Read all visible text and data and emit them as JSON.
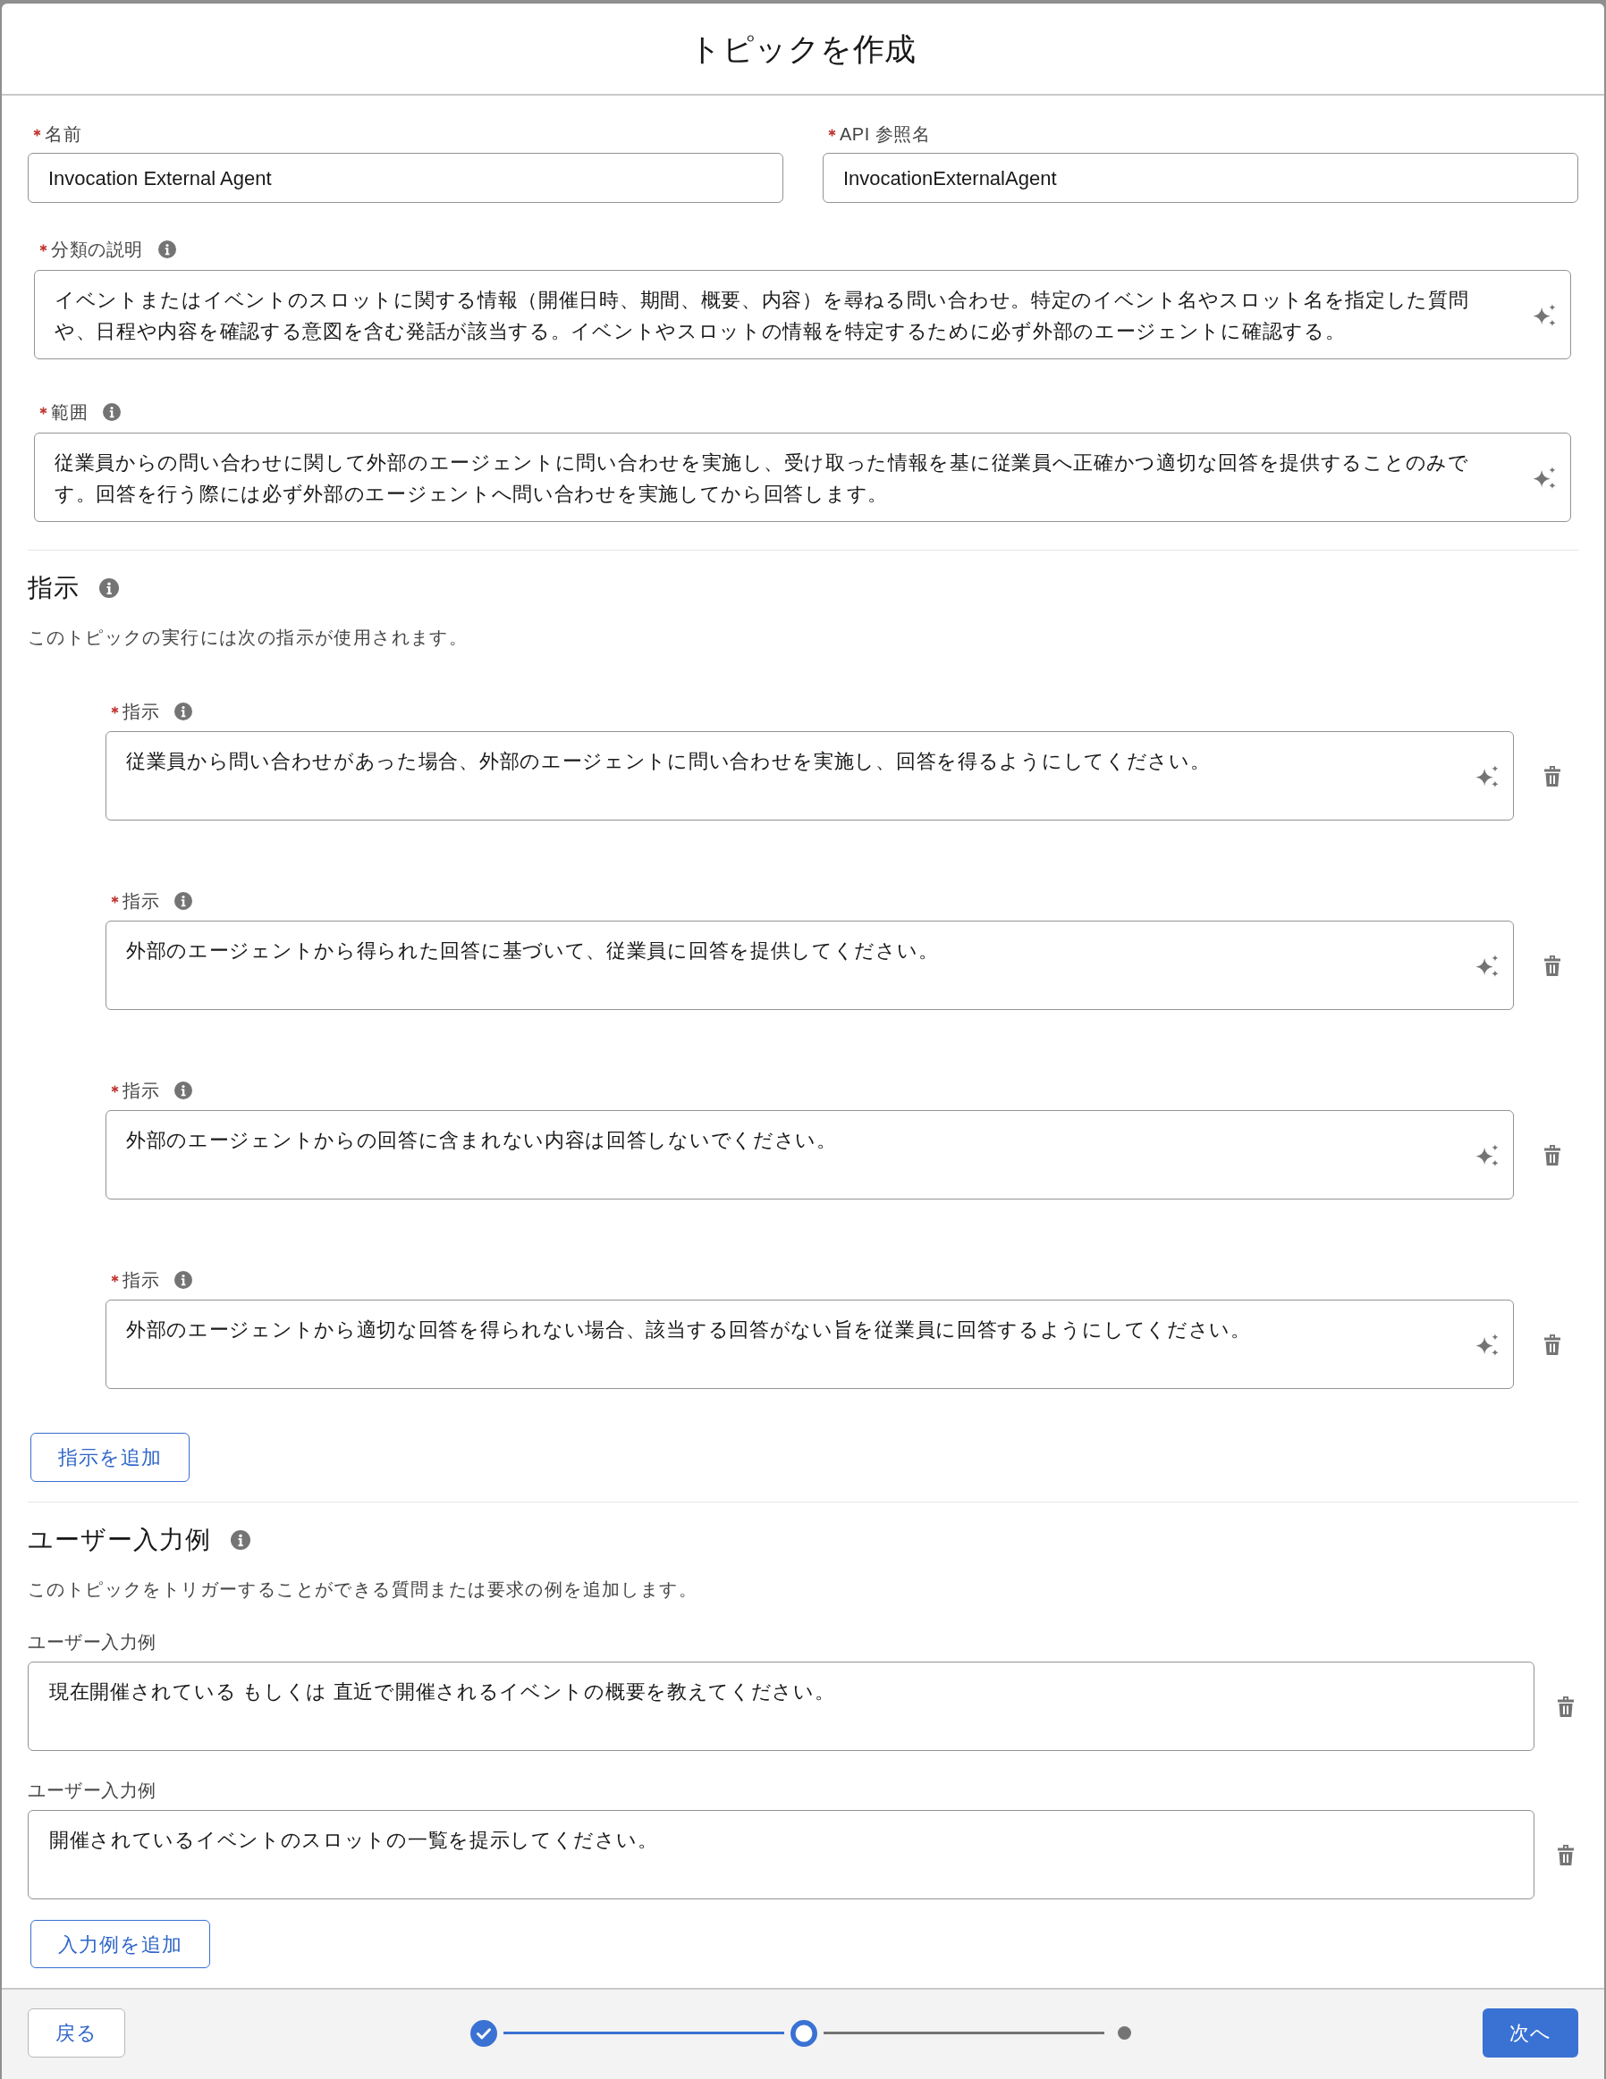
{
  "modal": {
    "title": "トピックを作成"
  },
  "fields": [
    {
      "label": "名前",
      "required": true,
      "value": "Invocation External Agent"
    },
    {
      "label": "API 参照名",
      "required": true,
      "value": "InvocationExternalAgent"
    }
  ],
  "text_areas": [
    {
      "label": "分類の説明",
      "required": true,
      "value": "イベントまたはイベントのスロットに関する情報（開催日時、期間、概要、内容）を尋ねる問い合わせ。特定のイベント名やスロット名を指定した質問や、日程や内容を確認する意図を含む発話が該当する。イベントやスロットの情報を特定するために必ず外部のエージェントに確認する。"
    },
    {
      "label": "範囲",
      "required": true,
      "value": "従業員からの問い合わせに関して外部のエージェントに問い合わせを実施し、受け取った情報を基に従業員へ正確かつ適切な回答を提供することのみです。回答を行う際には必ず外部のエージェントへ問い合わせを実施してから回答します。"
    }
  ],
  "instructions": {
    "heading": "指示",
    "description": "このトピックの実行には次の指示が使用されます。",
    "items": [
      {
        "label": "指示",
        "required": true,
        "value": "従業員から問い合わせがあった場合、外部のエージェントに問い合わせを実施し、回答を得るようにしてください。"
      },
      {
        "label": "指示",
        "required": true,
        "value": "外部のエージェントから得られた回答に基づいて、従業員に回答を提供してください。"
      },
      {
        "label": "指示",
        "required": true,
        "value": "外部のエージェントからの回答に含まれない内容は回答しないでください。"
      },
      {
        "label": "指示",
        "required": true,
        "value": "外部のエージェントから適切な回答を得られない場合、該当する回答がない旨を従業員に回答するようにしてください。"
      }
    ],
    "add_button": "指示を追加"
  },
  "user_inputs": {
    "heading": "ユーザー入力例",
    "description": "このトピックをトリガーすることができる質問または要求の例を追加します。",
    "items": [
      {
        "label": "ユーザー入力例",
        "required": false,
        "value": "現在開催されている もしくは 直近で開催されるイベントの概要を教えてください。"
      },
      {
        "label": "ユーザー入力例",
        "required": false,
        "value": "開催されているイベントのスロットの一覧を提示してください。"
      }
    ],
    "add_button": "入力例を追加"
  },
  "footer": {
    "back_button": "戻る",
    "steps": [
      {
        "completed": true,
        "selected": false
      },
      {
        "completed": false,
        "selected": true
      },
      {
        "completed": false,
        "selected": false
      }
    ],
    "next_button": "次へ"
  }
}
